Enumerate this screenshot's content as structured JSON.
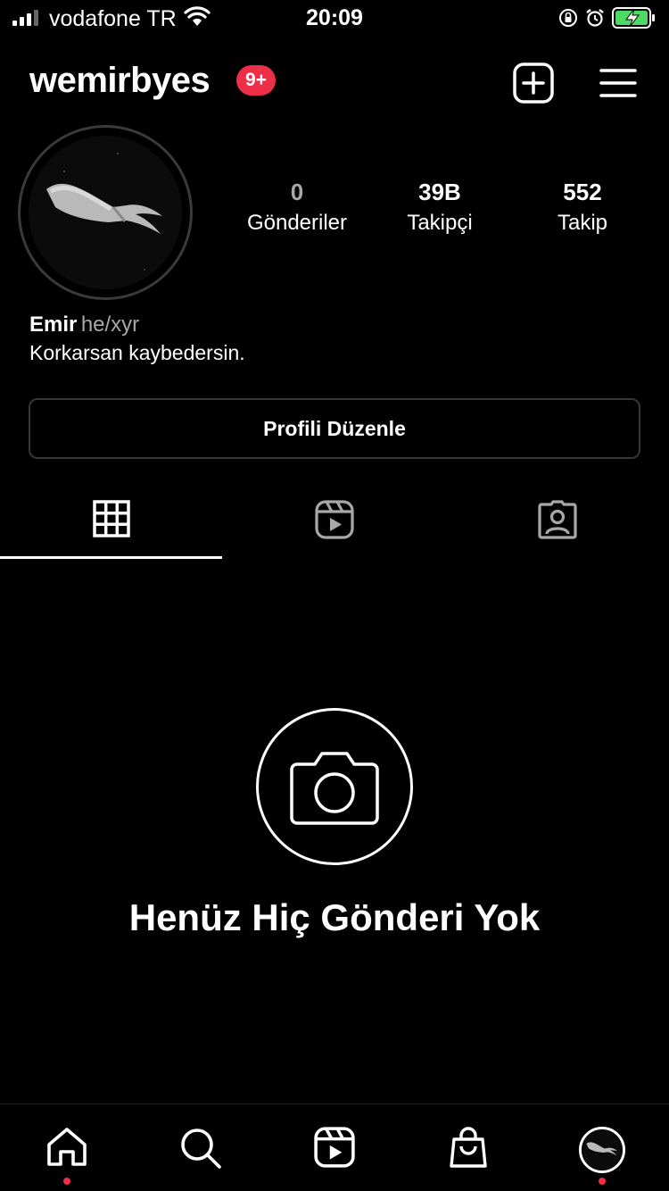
{
  "status_bar": {
    "carrier": "vodafone TR",
    "time": "20:09",
    "battery_color": "#4cd964"
  },
  "header": {
    "username": "wemirbyes",
    "notification_badge": "9+",
    "badge_color": "#ed2f47",
    "new_post_icon": "plus-square-icon",
    "menu_icon": "hamburger-menu-icon"
  },
  "profile": {
    "stats": [
      {
        "value": "0",
        "label": "Gönderiler"
      },
      {
        "value": "39B",
        "label": "Takipçi"
      },
      {
        "value": "552",
        "label": "Takip"
      }
    ],
    "name": "Emir",
    "pronouns": "he/xyr",
    "bio": "Korkarsan kaybedersin.",
    "edit_button": "Profili Düzenle"
  },
  "tabs": [
    {
      "icon": "grid-icon",
      "active": true
    },
    {
      "icon": "reels-icon",
      "active": false
    },
    {
      "icon": "tagged-icon",
      "active": false
    }
  ],
  "empty_state": {
    "icon": "camera-icon",
    "title": "Henüz Hiç Gönderi Yok"
  },
  "bottom_nav": [
    {
      "icon": "home-icon",
      "notification_dot": true
    },
    {
      "icon": "search-icon",
      "notification_dot": false
    },
    {
      "icon": "reels-icon",
      "notification_dot": false
    },
    {
      "icon": "shop-icon",
      "notification_dot": false
    },
    {
      "icon": "profile-avatar",
      "notification_dot": true
    }
  ]
}
